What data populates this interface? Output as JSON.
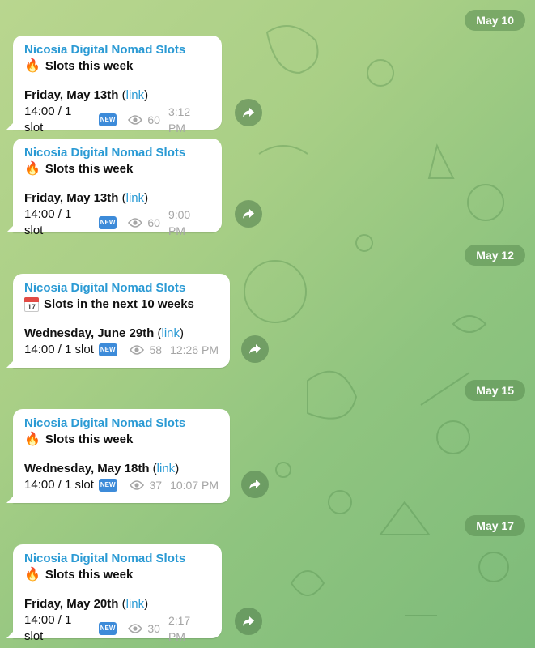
{
  "dates": [
    "May 10",
    "May 12",
    "May 15",
    "May 17"
  ],
  "messages": [
    {
      "channel": "Nicosia Digital Nomad Slots",
      "icon": "fire-icon",
      "headline": "Slots this week",
      "date": "Friday, May 13th",
      "link": "link",
      "slot": "14:00 / 1 slot",
      "badge": "NEW",
      "views": "60",
      "time": "3:12 PM"
    },
    {
      "channel": "Nicosia Digital Nomad Slots",
      "icon": "fire-icon",
      "headline": "Slots this week",
      "date": "Friday, May 13th",
      "link": "link",
      "slot": "14:00 / 1 slot",
      "badge": "NEW",
      "views": "60",
      "time": "9:00 PM"
    },
    {
      "channel": "Nicosia Digital Nomad Slots",
      "icon": "calendar-icon",
      "calendar_day": "17",
      "headline": "Slots in the next 10 weeks",
      "date": "Wednesday, June 29th",
      "link": "link",
      "slot": "14:00 / 1 slot",
      "badge": "NEW",
      "views": "58",
      "time": "12:26 PM"
    },
    {
      "channel": "Nicosia Digital Nomad Slots",
      "icon": "fire-icon",
      "headline": "Slots this week",
      "date": "Wednesday, May 18th",
      "link": "link",
      "slot": "14:00 / 1 slot",
      "badge": "NEW",
      "views": "37",
      "time": "10:07 PM"
    },
    {
      "channel": "Nicosia Digital Nomad Slots",
      "icon": "fire-icon",
      "headline": "Slots this week",
      "date": "Friday, May 20th",
      "link": "link",
      "slot": "14:00 / 1 slot",
      "badge": "NEW",
      "views": "30",
      "time": "2:17 PM"
    }
  ],
  "colors": {
    "channel": "#2a9ad4",
    "link": "#2a9ad4",
    "badge": "#3d8bd9",
    "meta": "#a5a5a5"
  }
}
